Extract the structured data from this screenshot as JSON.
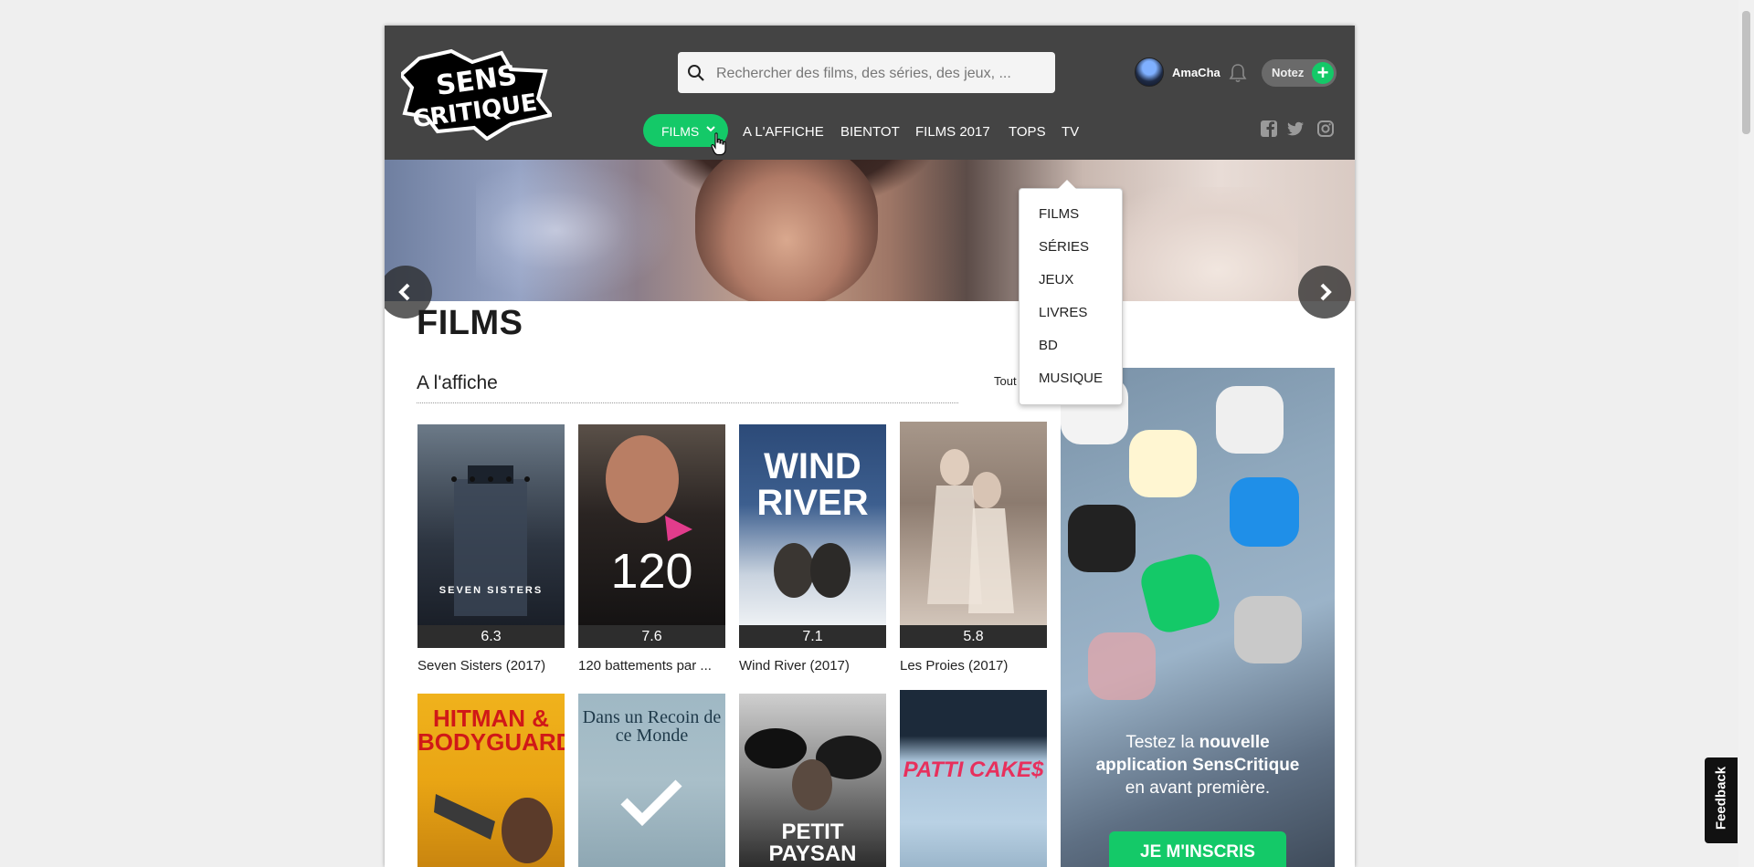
{
  "header": {
    "logo_text": "SENS CRITIQUE",
    "search": {
      "placeholder": "Rechercher des films, des séries, des jeux, ..."
    },
    "user": {
      "name": "AmaCha"
    },
    "notez_label": "Notez"
  },
  "nav": {
    "active": "FILMS",
    "items": [
      "A L'AFFICHE",
      "BIENTOT",
      "FILMS 2017",
      "TOPS",
      "TV"
    ]
  },
  "dropdown": {
    "items": [
      "FILMS",
      "SÉRIES",
      "JEUX",
      "LIVRES",
      "BD",
      "MUSIQUE"
    ]
  },
  "page": {
    "title": "FILMS",
    "section_title": "A l'affiche",
    "see_all": "Tout voir"
  },
  "movies": [
    {
      "title": "Seven Sisters (2017)",
      "score": "6.3",
      "poster_text": "SEVEN SISTERS"
    },
    {
      "title": "120 battements par ...",
      "score": "7.6",
      "poster_text": "120"
    },
    {
      "title": "Wind River (2017)",
      "score": "7.1",
      "poster_text": "WIND RIVER"
    },
    {
      "title": "Les Proies (2017)",
      "score": "5.8",
      "poster_text": ""
    }
  ],
  "movies_row2": [
    {
      "poster_text": "HITMAN & BODYGUARD"
    },
    {
      "poster_text": "Dans un Recoin de ce Monde"
    },
    {
      "poster_text": "PETIT PAYSAN"
    },
    {
      "poster_text": "PATTI CAKE$"
    }
  ],
  "ad": {
    "line1_plain": "Testez la ",
    "line1_bold": "nouvelle",
    "line2_bold": "application SensCritique",
    "line3": "en avant première.",
    "cta": "JE M'INSCRIS"
  },
  "feedback_label": "Feedback",
  "colors": {
    "accent": "#14c968",
    "header_bg": "#444444"
  }
}
